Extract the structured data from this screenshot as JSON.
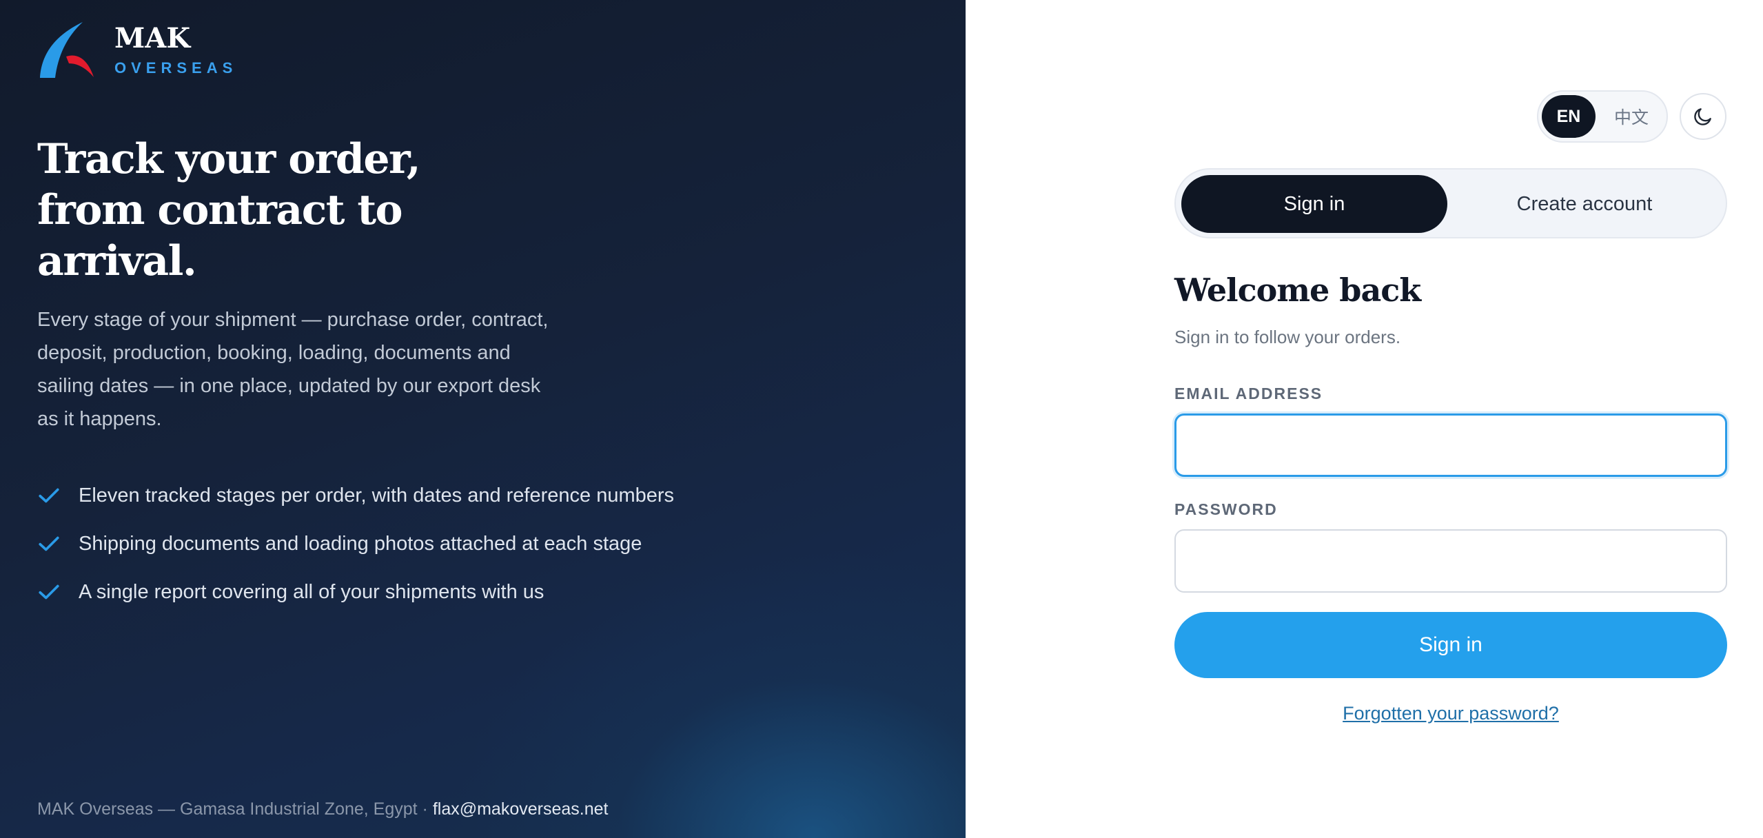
{
  "brand": {
    "name": "MAK",
    "subtitle": "OVERSEAS",
    "colors": {
      "blue": "#2a9be8",
      "red": "#e21b2d",
      "navy": "#0f1623"
    }
  },
  "hero": {
    "title": "Track your order, from contract to arrival.",
    "description": "Every stage of your shipment — purchase order, contract, deposit, production, booking, loading, documents and sailing dates — in one place, updated by our export desk as it happens.",
    "features": [
      {
        "text": "Eleven tracked stages per order, with dates and reference numbers",
        "icon": "check-icon"
      },
      {
        "text": "Shipping documents and loading photos attached at each stage",
        "icon": "check-icon"
      },
      {
        "text": "A single report covering all of your shipments with us",
        "icon": "check-icon"
      }
    ]
  },
  "footer": {
    "address": "MAK Overseas — Gamasa Industrial Zone, Egypt · ",
    "email": "flax@makoverseas.net"
  },
  "lang": {
    "en": "EN",
    "zh": "中文",
    "selected": "EN"
  },
  "theme_toggle": {
    "icon": "moon-icon"
  },
  "auth_tabs": {
    "signin": "Sign in",
    "create": "Create account",
    "active": "Sign in"
  },
  "form": {
    "heading": "Welcome back",
    "subheading": "Sign in to follow your orders.",
    "email_label": "EMAIL ADDRESS",
    "email_value": "",
    "email_placeholder": "",
    "password_label": "PASSWORD",
    "password_value": "",
    "password_placeholder": "",
    "submit_label": "Sign in",
    "forgot_label": "Forgotten your password?"
  }
}
